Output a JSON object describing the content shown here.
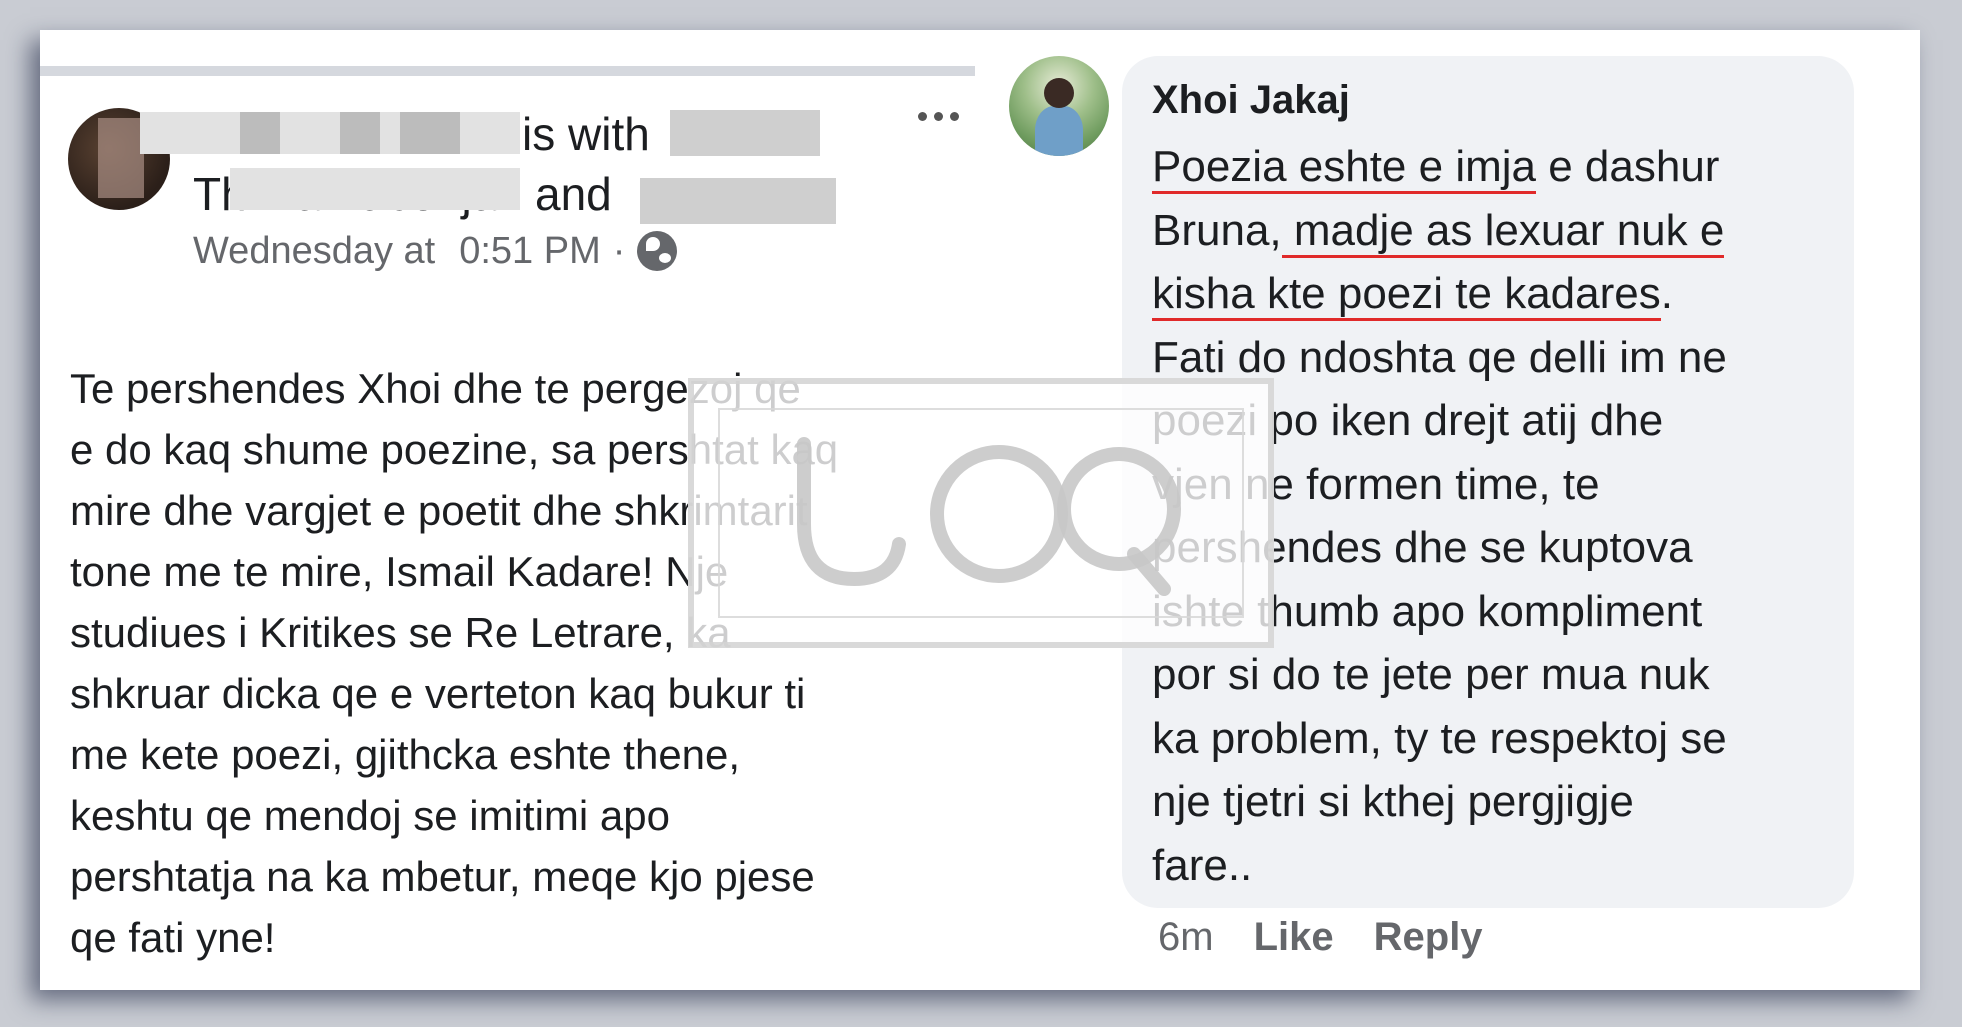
{
  "post": {
    "header_with": "is with",
    "header_and": "and",
    "header_name_fragment": "Thima Lubonja",
    "time_label": "Wednesday at",
    "time": "0:51 PM",
    "dot": "·",
    "privacy_icon": "globe-icon",
    "more_icon": "more-options-icon",
    "body_lines": [
      "Te pershendes Xhoi dhe  te pergezoj qe",
      "e do kaq shume poezine, sa pershtat kaq",
      "mire dhe vargjet e poetit dhe shkrimtarit",
      "tone me te mire, Ismail Kadare! Nje",
      "studiues i Kritikes se Re Letrare, ka",
      "shkruar dicka qe e verteton kaq bukur ti",
      "me kete poezi, gjithcka eshte thene,",
      "keshtu qe mendoj se imitimi apo",
      "pershtatja na ka mbetur, meqe  kjo pjese",
      "qe fati yne!"
    ]
  },
  "comment": {
    "author": "Xhoi Jakaj",
    "line1_underlined": "Poezia eshte e imja",
    "line1_rest": " e dashur",
    "line2_prefix": "Bruna,",
    "line2_underlined": " madje as lexuar nuk e",
    "line3_underlined": "kisha kte poezi te kadares",
    "line3_rest": ".",
    "lines": [
      "Fati do ndoshta qe delli im ne",
      "poezi po iken drejt atij dhe",
      "vjen ne formen time, te",
      "pershendes dhe se kuptova",
      "ishte thumb apo kompliment",
      "por si do te jete per mua nuk",
      "ka problem, ty te respektoj se",
      "nje tjetri si kthej pergjigje",
      "fare.."
    ],
    "time_ago": "6m",
    "like_label": "Like",
    "reply_label": "Reply"
  },
  "watermark": {
    "text": "JOQ"
  }
}
